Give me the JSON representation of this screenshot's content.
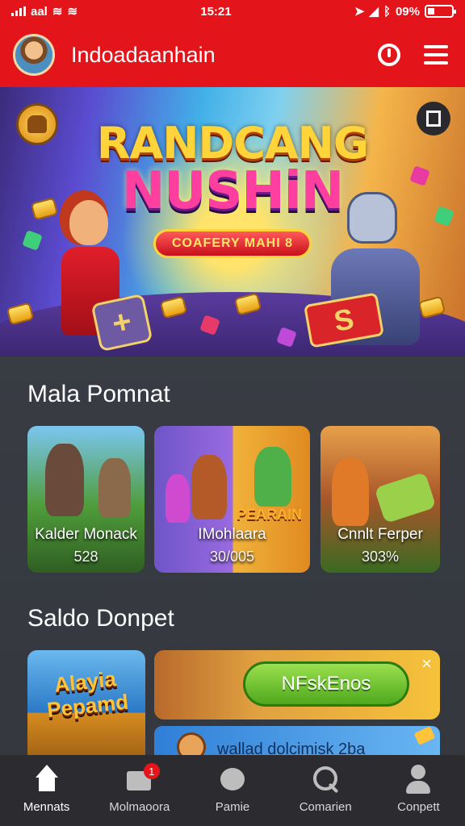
{
  "status_bar": {
    "carrier": "aal",
    "time": "15:21",
    "battery": "09%"
  },
  "header": {
    "title": "Indoadaanhain"
  },
  "banner": {
    "title_line1": "RANDCANG",
    "title_line2": "NUSHiN",
    "subtitle": "COAFERY MAHI 8",
    "tile_plus": "+",
    "tile_s": "S"
  },
  "games_section": {
    "title": "Mala Pomnat",
    "cards": [
      {
        "label": "Kalder Monack",
        "value": "528"
      },
      {
        "label": "IMohlaara",
        "value": "30/005",
        "art_title": "PEARAIN"
      },
      {
        "label": "Cnnlt Ferper",
        "value": "303%"
      }
    ]
  },
  "wallet_section": {
    "title": "Saldo Donpet",
    "promo_text": "Alayia Pepamd",
    "redeem_label": "NFskEnos",
    "close": "×",
    "strip_text": "wallad dolcimisk 2ba"
  },
  "bottom_nav": {
    "items": [
      {
        "label": "Mennats"
      },
      {
        "label": "Molmaoora",
        "badge": "1"
      },
      {
        "label": "Pamie"
      },
      {
        "label": "Comarien"
      },
      {
        "label": "Conpett"
      }
    ]
  },
  "colors": {
    "brand": "#e4141b",
    "nav_bg": "#2c2c30",
    "page_bg": "#3a3d45"
  }
}
